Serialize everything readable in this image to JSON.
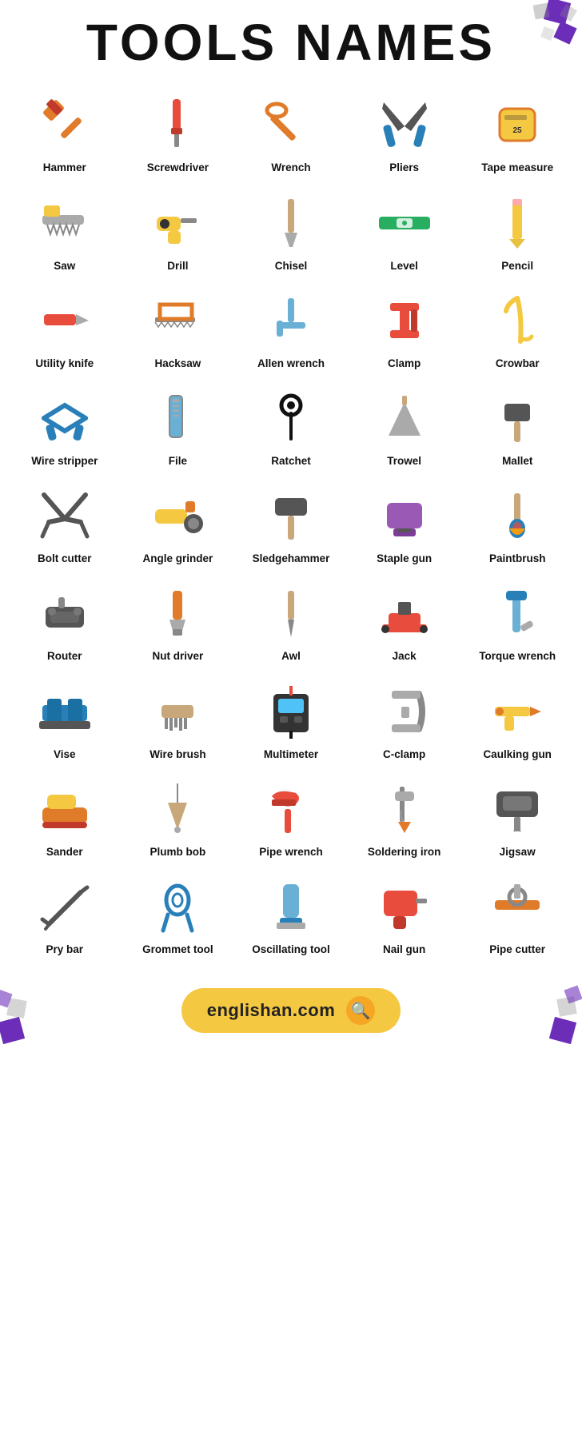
{
  "header": {
    "title": "TOOLS NAMES"
  },
  "tools": [
    {
      "id": "hammer",
      "label": "Hammer",
      "emoji": "🔨"
    },
    {
      "id": "screwdriver",
      "label": "Screwdriver",
      "emoji": "🪛"
    },
    {
      "id": "wrench",
      "label": "Wrench",
      "emoji": "🔧"
    },
    {
      "id": "pliers",
      "label": "Pliers",
      "emoji": "🪚"
    },
    {
      "id": "tape-measure",
      "label": "Tape measure",
      "emoji": "📏"
    },
    {
      "id": "saw",
      "label": "Saw",
      "emoji": "🪚"
    },
    {
      "id": "drill",
      "label": "Drill",
      "emoji": "🔩"
    },
    {
      "id": "chisel",
      "label": "Chisel",
      "emoji": "🗡️"
    },
    {
      "id": "level",
      "label": "Level",
      "emoji": "📐"
    },
    {
      "id": "pencil",
      "label": "Pencil",
      "emoji": "✏️"
    },
    {
      "id": "utility-knife",
      "label": "Utility knife",
      "emoji": "🔪"
    },
    {
      "id": "hacksaw",
      "label": "Hacksaw",
      "emoji": "🪚"
    },
    {
      "id": "allen-wrench",
      "label": "Allen wrench",
      "emoji": "🔧"
    },
    {
      "id": "clamp",
      "label": "Clamp",
      "emoji": "🗜️"
    },
    {
      "id": "crowbar",
      "label": "Crowbar",
      "emoji": "🔱"
    },
    {
      "id": "wire-stripper",
      "label": "Wire stripper",
      "emoji": "✂️"
    },
    {
      "id": "file",
      "label": "File",
      "emoji": "📁"
    },
    {
      "id": "ratchet",
      "label": "Ratchet",
      "emoji": "🔩"
    },
    {
      "id": "trowel",
      "label": "Trowel",
      "emoji": "🏗️"
    },
    {
      "id": "mallet",
      "label": "Mallet",
      "emoji": "🔨"
    },
    {
      "id": "bolt-cutter",
      "label": "Bolt cutter",
      "emoji": "✂️"
    },
    {
      "id": "angle-grinder",
      "label": "Angle grinder",
      "emoji": "⚙️"
    },
    {
      "id": "sledgehammer",
      "label": "Sledgehammer",
      "emoji": "🔨"
    },
    {
      "id": "staple-gun",
      "label": "Staple gun",
      "emoji": "🔫"
    },
    {
      "id": "paintbrush",
      "label": "Paintbrush",
      "emoji": "🖌️"
    },
    {
      "id": "router",
      "label": "Router",
      "emoji": "⚙️"
    },
    {
      "id": "nut-driver",
      "label": "Nut driver",
      "emoji": "🪛"
    },
    {
      "id": "awl",
      "label": "Awl",
      "emoji": "📌"
    },
    {
      "id": "jack",
      "label": "Jack",
      "emoji": "🔧"
    },
    {
      "id": "torque-wrench",
      "label": "Torque wrench",
      "emoji": "🔧"
    },
    {
      "id": "vise",
      "label": "Vise",
      "emoji": "🗜️"
    },
    {
      "id": "wire-brush",
      "label": "Wire brush",
      "emoji": "🪥"
    },
    {
      "id": "multimeter",
      "label": "Multimeter",
      "emoji": "🔌"
    },
    {
      "id": "c-clamp",
      "label": "C-clamp",
      "emoji": "🗜️"
    },
    {
      "id": "caulking-gun",
      "label": "Caulking gun",
      "emoji": "🔫"
    },
    {
      "id": "sander",
      "label": "Sander",
      "emoji": "⚙️"
    },
    {
      "id": "plumb-bob",
      "label": "Plumb bob",
      "emoji": "📍"
    },
    {
      "id": "pipe-wrench",
      "label": "Pipe wrench",
      "emoji": "🔧"
    },
    {
      "id": "soldering-iron",
      "label": "Soldering iron",
      "emoji": "🔌"
    },
    {
      "id": "jigsaw",
      "label": "Jigsaw",
      "emoji": "🪚"
    },
    {
      "id": "pry-bar",
      "label": "Pry bar",
      "emoji": "🔱"
    },
    {
      "id": "grommet-tool",
      "label": "Grommet tool",
      "emoji": "⚙️"
    },
    {
      "id": "oscillating-tool",
      "label": "Oscillating tool",
      "emoji": "🪚"
    },
    {
      "id": "nail-gun",
      "label": "Nail gun",
      "emoji": "🔫"
    },
    {
      "id": "pipe-cutter",
      "label": "Pipe cutter",
      "emoji": "✂️"
    }
  ],
  "footer": {
    "url": "englishan.com",
    "search_icon": "🔍"
  }
}
